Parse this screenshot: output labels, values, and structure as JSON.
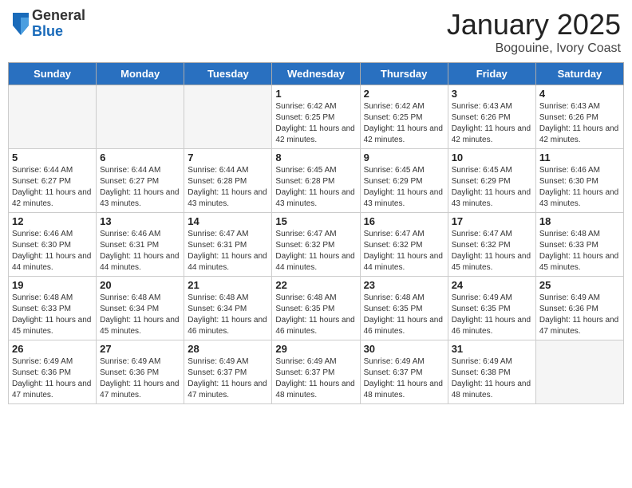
{
  "header": {
    "logo_general": "General",
    "logo_blue": "Blue",
    "month_title": "January 2025",
    "location": "Bogouine, Ivory Coast"
  },
  "weekdays": [
    "Sunday",
    "Monday",
    "Tuesday",
    "Wednesday",
    "Thursday",
    "Friday",
    "Saturday"
  ],
  "weeks": [
    [
      {
        "day": "",
        "info": ""
      },
      {
        "day": "",
        "info": ""
      },
      {
        "day": "",
        "info": ""
      },
      {
        "day": "1",
        "info": "Sunrise: 6:42 AM\nSunset: 6:25 PM\nDaylight: 11 hours and 42 minutes."
      },
      {
        "day": "2",
        "info": "Sunrise: 6:42 AM\nSunset: 6:25 PM\nDaylight: 11 hours and 42 minutes."
      },
      {
        "day": "3",
        "info": "Sunrise: 6:43 AM\nSunset: 6:26 PM\nDaylight: 11 hours and 42 minutes."
      },
      {
        "day": "4",
        "info": "Sunrise: 6:43 AM\nSunset: 6:26 PM\nDaylight: 11 hours and 42 minutes."
      }
    ],
    [
      {
        "day": "5",
        "info": "Sunrise: 6:44 AM\nSunset: 6:27 PM\nDaylight: 11 hours and 42 minutes."
      },
      {
        "day": "6",
        "info": "Sunrise: 6:44 AM\nSunset: 6:27 PM\nDaylight: 11 hours and 43 minutes."
      },
      {
        "day": "7",
        "info": "Sunrise: 6:44 AM\nSunset: 6:28 PM\nDaylight: 11 hours and 43 minutes."
      },
      {
        "day": "8",
        "info": "Sunrise: 6:45 AM\nSunset: 6:28 PM\nDaylight: 11 hours and 43 minutes."
      },
      {
        "day": "9",
        "info": "Sunrise: 6:45 AM\nSunset: 6:29 PM\nDaylight: 11 hours and 43 minutes."
      },
      {
        "day": "10",
        "info": "Sunrise: 6:45 AM\nSunset: 6:29 PM\nDaylight: 11 hours and 43 minutes."
      },
      {
        "day": "11",
        "info": "Sunrise: 6:46 AM\nSunset: 6:30 PM\nDaylight: 11 hours and 43 minutes."
      }
    ],
    [
      {
        "day": "12",
        "info": "Sunrise: 6:46 AM\nSunset: 6:30 PM\nDaylight: 11 hours and 44 minutes."
      },
      {
        "day": "13",
        "info": "Sunrise: 6:46 AM\nSunset: 6:31 PM\nDaylight: 11 hours and 44 minutes."
      },
      {
        "day": "14",
        "info": "Sunrise: 6:47 AM\nSunset: 6:31 PM\nDaylight: 11 hours and 44 minutes."
      },
      {
        "day": "15",
        "info": "Sunrise: 6:47 AM\nSunset: 6:32 PM\nDaylight: 11 hours and 44 minutes."
      },
      {
        "day": "16",
        "info": "Sunrise: 6:47 AM\nSunset: 6:32 PM\nDaylight: 11 hours and 44 minutes."
      },
      {
        "day": "17",
        "info": "Sunrise: 6:47 AM\nSunset: 6:32 PM\nDaylight: 11 hours and 45 minutes."
      },
      {
        "day": "18",
        "info": "Sunrise: 6:48 AM\nSunset: 6:33 PM\nDaylight: 11 hours and 45 minutes."
      }
    ],
    [
      {
        "day": "19",
        "info": "Sunrise: 6:48 AM\nSunset: 6:33 PM\nDaylight: 11 hours and 45 minutes."
      },
      {
        "day": "20",
        "info": "Sunrise: 6:48 AM\nSunset: 6:34 PM\nDaylight: 11 hours and 45 minutes."
      },
      {
        "day": "21",
        "info": "Sunrise: 6:48 AM\nSunset: 6:34 PM\nDaylight: 11 hours and 46 minutes."
      },
      {
        "day": "22",
        "info": "Sunrise: 6:48 AM\nSunset: 6:35 PM\nDaylight: 11 hours and 46 minutes."
      },
      {
        "day": "23",
        "info": "Sunrise: 6:48 AM\nSunset: 6:35 PM\nDaylight: 11 hours and 46 minutes."
      },
      {
        "day": "24",
        "info": "Sunrise: 6:49 AM\nSunset: 6:35 PM\nDaylight: 11 hours and 46 minutes."
      },
      {
        "day": "25",
        "info": "Sunrise: 6:49 AM\nSunset: 6:36 PM\nDaylight: 11 hours and 47 minutes."
      }
    ],
    [
      {
        "day": "26",
        "info": "Sunrise: 6:49 AM\nSunset: 6:36 PM\nDaylight: 11 hours and 47 minutes."
      },
      {
        "day": "27",
        "info": "Sunrise: 6:49 AM\nSunset: 6:36 PM\nDaylight: 11 hours and 47 minutes."
      },
      {
        "day": "28",
        "info": "Sunrise: 6:49 AM\nSunset: 6:37 PM\nDaylight: 11 hours and 47 minutes."
      },
      {
        "day": "29",
        "info": "Sunrise: 6:49 AM\nSunset: 6:37 PM\nDaylight: 11 hours and 48 minutes."
      },
      {
        "day": "30",
        "info": "Sunrise: 6:49 AM\nSunset: 6:37 PM\nDaylight: 11 hours and 48 minutes."
      },
      {
        "day": "31",
        "info": "Sunrise: 6:49 AM\nSunset: 6:38 PM\nDaylight: 11 hours and 48 minutes."
      },
      {
        "day": "",
        "info": ""
      }
    ]
  ]
}
